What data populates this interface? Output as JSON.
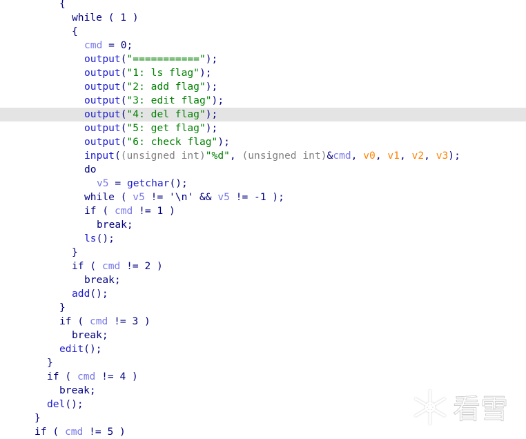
{
  "colors": {
    "keyword": "#000080",
    "function": "#1a1ad0",
    "variable": "#7878e8",
    "cast": "#808080",
    "string": "#008000",
    "argument": "#ff8000",
    "highlight": "#e4e4e4"
  },
  "highlighted_line": 8,
  "watermark": {
    "icon": "snowflake-icon",
    "text": "看雪"
  },
  "lines": [
    {
      "indent": 4,
      "tokens": [
        [
          "{",
          "n"
        ]
      ]
    },
    {
      "indent": 6,
      "tokens": [
        [
          "while ( 1 )",
          "n"
        ]
      ]
    },
    {
      "indent": 6,
      "tokens": [
        [
          "{",
          "n"
        ]
      ]
    },
    {
      "indent": 8,
      "tokens": [
        [
          "cmd",
          "v"
        ],
        [
          " = 0;",
          "n"
        ]
      ]
    },
    {
      "indent": 8,
      "tokens": [
        [
          "output",
          "f"
        ],
        [
          "(",
          "n"
        ],
        [
          "\"===========\"",
          "s"
        ],
        [
          ");",
          "n"
        ]
      ]
    },
    {
      "indent": 8,
      "tokens": [
        [
          "output",
          "f"
        ],
        [
          "(",
          "n"
        ],
        [
          "\"1: ls flag\"",
          "s"
        ],
        [
          ");",
          "n"
        ]
      ]
    },
    {
      "indent": 8,
      "tokens": [
        [
          "output",
          "f"
        ],
        [
          "(",
          "n"
        ],
        [
          "\"2: add flag\"",
          "s"
        ],
        [
          ");",
          "n"
        ]
      ]
    },
    {
      "indent": 8,
      "tokens": [
        [
          "output",
          "f"
        ],
        [
          "(",
          "n"
        ],
        [
          "\"3: edit flag\"",
          "s"
        ],
        [
          ");",
          "n"
        ]
      ]
    },
    {
      "indent": 8,
      "tokens": [
        [
          "output",
          "f"
        ],
        [
          "(",
          "n"
        ],
        [
          "\"4: del flag\"",
          "s"
        ],
        [
          ");",
          "n"
        ]
      ]
    },
    {
      "indent": 8,
      "tokens": [
        [
          "output",
          "f"
        ],
        [
          "(",
          "n"
        ],
        [
          "\"5: get flag\"",
          "s"
        ],
        [
          ");",
          "n"
        ]
      ]
    },
    {
      "indent": 8,
      "tokens": [
        [
          "output",
          "f"
        ],
        [
          "(",
          "n"
        ],
        [
          "\"6: check flag\"",
          "s"
        ],
        [
          ");",
          "n"
        ]
      ]
    },
    {
      "indent": 8,
      "tokens": [
        [
          "input",
          "f"
        ],
        [
          "(",
          "n"
        ],
        [
          "(unsigned int)",
          "g"
        ],
        [
          "\"%d\"",
          "s"
        ],
        [
          ", ",
          "n"
        ],
        [
          "(unsigned int)",
          "g"
        ],
        [
          "&",
          "n"
        ],
        [
          "cmd",
          "v"
        ],
        [
          ", ",
          "n"
        ],
        [
          "v0",
          "o"
        ],
        [
          ", ",
          "n"
        ],
        [
          "v1",
          "o"
        ],
        [
          ", ",
          "n"
        ],
        [
          "v2",
          "o"
        ],
        [
          ", ",
          "n"
        ],
        [
          "v3",
          "o"
        ],
        [
          ");",
          "n"
        ]
      ]
    },
    {
      "indent": 8,
      "tokens": [
        [
          "do",
          "n"
        ]
      ]
    },
    {
      "indent": 10,
      "tokens": [
        [
          "v5",
          "v"
        ],
        [
          " = ",
          "n"
        ],
        [
          "getchar",
          "f"
        ],
        [
          "();",
          "n"
        ]
      ]
    },
    {
      "indent": 8,
      "tokens": [
        [
          "while ( ",
          "n"
        ],
        [
          "v5",
          "v"
        ],
        [
          " != '\\n' && ",
          "n"
        ],
        [
          "v5",
          "v"
        ],
        [
          " != -1 );",
          "n"
        ]
      ]
    },
    {
      "indent": 8,
      "tokens": [
        [
          "if ( ",
          "n"
        ],
        [
          "cmd",
          "v"
        ],
        [
          " != 1 )",
          "n"
        ]
      ]
    },
    {
      "indent": 10,
      "tokens": [
        [
          "break;",
          "n"
        ]
      ]
    },
    {
      "indent": 8,
      "tokens": [
        [
          "ls",
          "f"
        ],
        [
          "();",
          "n"
        ]
      ]
    },
    {
      "indent": 6,
      "tokens": [
        [
          "}",
          "n"
        ]
      ]
    },
    {
      "indent": 6,
      "tokens": [
        [
          "if ( ",
          "n"
        ],
        [
          "cmd",
          "v"
        ],
        [
          " != 2 )",
          "n"
        ]
      ]
    },
    {
      "indent": 8,
      "tokens": [
        [
          "break;",
          "n"
        ]
      ]
    },
    {
      "indent": 6,
      "tokens": [
        [
          "add",
          "f"
        ],
        [
          "();",
          "n"
        ]
      ]
    },
    {
      "indent": 4,
      "tokens": [
        [
          "}",
          "n"
        ]
      ]
    },
    {
      "indent": 4,
      "tokens": [
        [
          "if ( ",
          "n"
        ],
        [
          "cmd",
          "v"
        ],
        [
          " != 3 )",
          "n"
        ]
      ]
    },
    {
      "indent": 6,
      "tokens": [
        [
          "break;",
          "n"
        ]
      ]
    },
    {
      "indent": 4,
      "tokens": [
        [
          "edit",
          "f"
        ],
        [
          "();",
          "n"
        ]
      ]
    },
    {
      "indent": 2,
      "tokens": [
        [
          "}",
          "n"
        ]
      ]
    },
    {
      "indent": 2,
      "tokens": [
        [
          "if ( ",
          "n"
        ],
        [
          "cmd",
          "v"
        ],
        [
          " != 4 )",
          "n"
        ]
      ]
    },
    {
      "indent": 4,
      "tokens": [
        [
          "break;",
          "n"
        ]
      ]
    },
    {
      "indent": 2,
      "tokens": [
        [
          "del",
          "f"
        ],
        [
          "();",
          "n"
        ]
      ]
    },
    {
      "indent": 0,
      "tokens": [
        [
          "}",
          "n"
        ]
      ]
    },
    {
      "indent": 0,
      "tokens": [
        [
          "if ( ",
          "n"
        ],
        [
          "cmd",
          "v"
        ],
        [
          " != 5 )",
          "n"
        ]
      ]
    }
  ]
}
